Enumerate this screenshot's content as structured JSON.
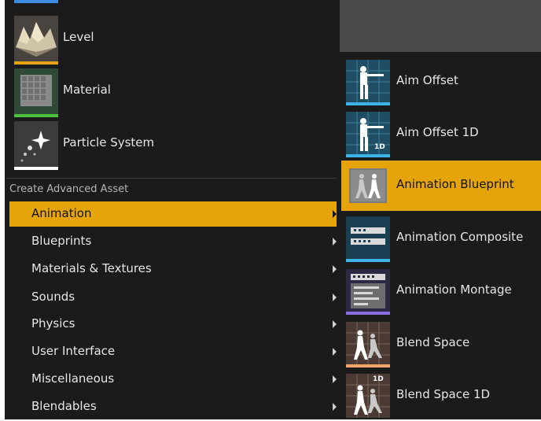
{
  "colors": {
    "selected": "#e5a50a",
    "level_bar": "#e5a50a",
    "material_bar": "#4ec23c",
    "particle_bar": "#ffffff",
    "aim_bar": "#3db2e6",
    "composite_bar": "#3db2e6",
    "montage_bar": "#8a6ee6",
    "blend_bar": "#f2a46a"
  },
  "quick_assets": [
    {
      "label": "Level",
      "icon": "level-terrain-icon"
    },
    {
      "label": "Material",
      "icon": "material-grid-icon"
    },
    {
      "label": "Particle System",
      "icon": "particle-sparkle-icon"
    }
  ],
  "section_title": "Create Advanced Asset",
  "categories": [
    {
      "label": "Animation",
      "selected": true
    },
    {
      "label": "Blueprints"
    },
    {
      "label": "Materials & Textures"
    },
    {
      "label": "Sounds"
    },
    {
      "label": "Physics"
    },
    {
      "label": "User Interface"
    },
    {
      "label": "Miscellaneous"
    },
    {
      "label": "Blendables"
    }
  ],
  "submenu": [
    {
      "label": "Aim Offset",
      "icon": "aim-offset-icon"
    },
    {
      "label": "Aim Offset 1D",
      "icon": "aim-offset-1d-icon",
      "badge": "1D"
    },
    {
      "label": "Animation Blueprint",
      "icon": "animation-blueprint-icon",
      "selected": true
    },
    {
      "label": "Animation Composite",
      "icon": "animation-composite-icon"
    },
    {
      "label": "Animation Montage",
      "icon": "animation-montage-icon"
    },
    {
      "label": "Blend Space",
      "icon": "blend-space-icon"
    },
    {
      "label": "Blend Space 1D",
      "icon": "blend-space-1d-icon",
      "badge": "1D"
    }
  ]
}
